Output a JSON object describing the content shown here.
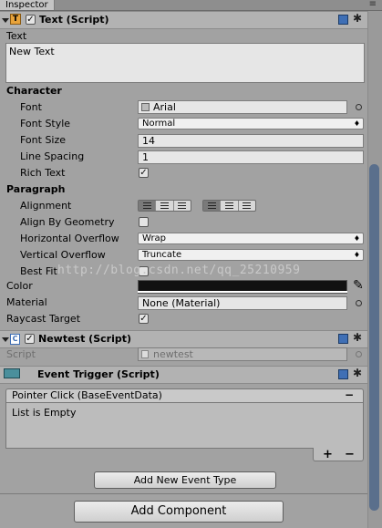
{
  "tab": {
    "label": "Inspector",
    "menu": "≡"
  },
  "text_component": {
    "title": "Text (Script)",
    "text_label": "Text",
    "text_value": "New Text",
    "character_section": "Character",
    "font_label": "Font",
    "font_value": "Arial",
    "font_style_label": "Font Style",
    "font_style_value": "Normal",
    "font_size_label": "Font Size",
    "font_size_value": "14",
    "line_spacing_label": "Line Spacing",
    "line_spacing_value": "1",
    "rich_text_label": "Rich Text",
    "paragraph_section": "Paragraph",
    "alignment_label": "Alignment",
    "align_geometry_label": "Align By Geometry",
    "h_overflow_label": "Horizontal Overflow",
    "h_overflow_value": "Wrap",
    "v_overflow_label": "Vertical Overflow",
    "v_overflow_value": "Truncate",
    "best_fit_label": "Best Fit",
    "color_label": "Color",
    "material_label": "Material",
    "material_value": "None (Material)",
    "raycast_label": "Raycast Target",
    "checkmark": "✓"
  },
  "newtest_component": {
    "title": "Newtest (Script)",
    "script_label": "Script",
    "script_value": "newtest"
  },
  "event_trigger": {
    "title": "Event Trigger (Script)",
    "event_header": "Pointer Click (BaseEventData)",
    "remove": "−",
    "list_empty": "List is Empty",
    "add": "+",
    "minus": "−",
    "add_event_button": "Add New Event Type"
  },
  "add_component_button": "Add Component",
  "watermark": "http://blog.csdn.net/qq_25210959",
  "colors": {
    "accent": "#3f6fb5",
    "panel": "#a2a2a2",
    "header": "#b2b2b2"
  }
}
